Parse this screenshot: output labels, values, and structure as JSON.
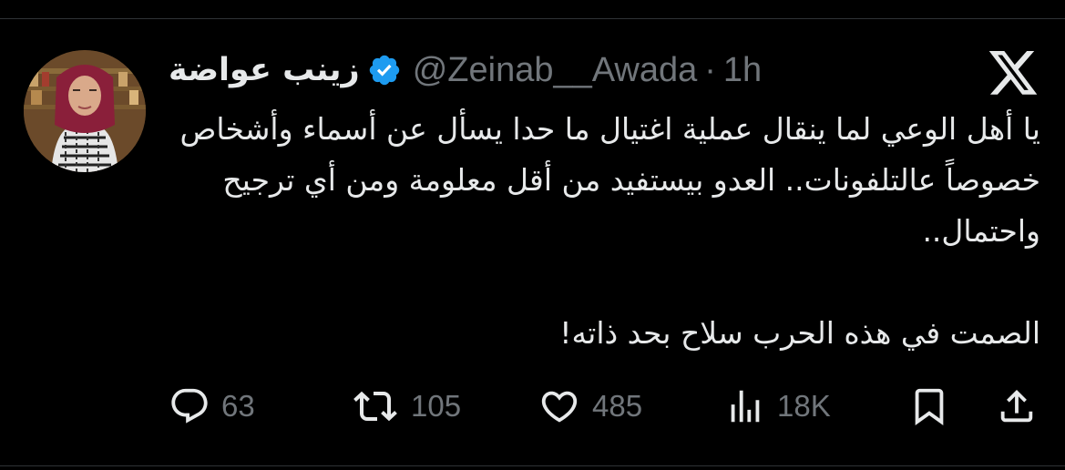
{
  "tweet": {
    "author": {
      "display_name": "زينب عواضة",
      "handle": "@Zeinab__Awada",
      "verified": true,
      "avatar": "profile-photo"
    },
    "separator": "·",
    "time": "1h",
    "platform_logo": "x-logo",
    "body": {
      "line1": "يا أهل الوعي لما ينقال عملية اغتيال ما حدا يسأل عن أسماء وأشخاص خصوصاً عالتلفونات.. العدو بيستفيد من أقل معلومة ومن أي ترجيح واحتمال..",
      "line2": "الصمت في هذه الحرب سلاح بحد ذاته!"
    },
    "stats": {
      "replies": "63",
      "reposts": "105",
      "likes": "485",
      "views": "18K"
    },
    "icons": {
      "reply": "reply-icon",
      "repost": "repost-icon",
      "like": "heart-icon",
      "views": "views-icon",
      "bookmark": "bookmark-icon",
      "share": "share-icon",
      "verified": "verified-badge-icon"
    },
    "colors": {
      "background": "#000000",
      "text": "#e7e9ea",
      "muted": "#71767b",
      "verified": "#1d9bf0"
    }
  }
}
